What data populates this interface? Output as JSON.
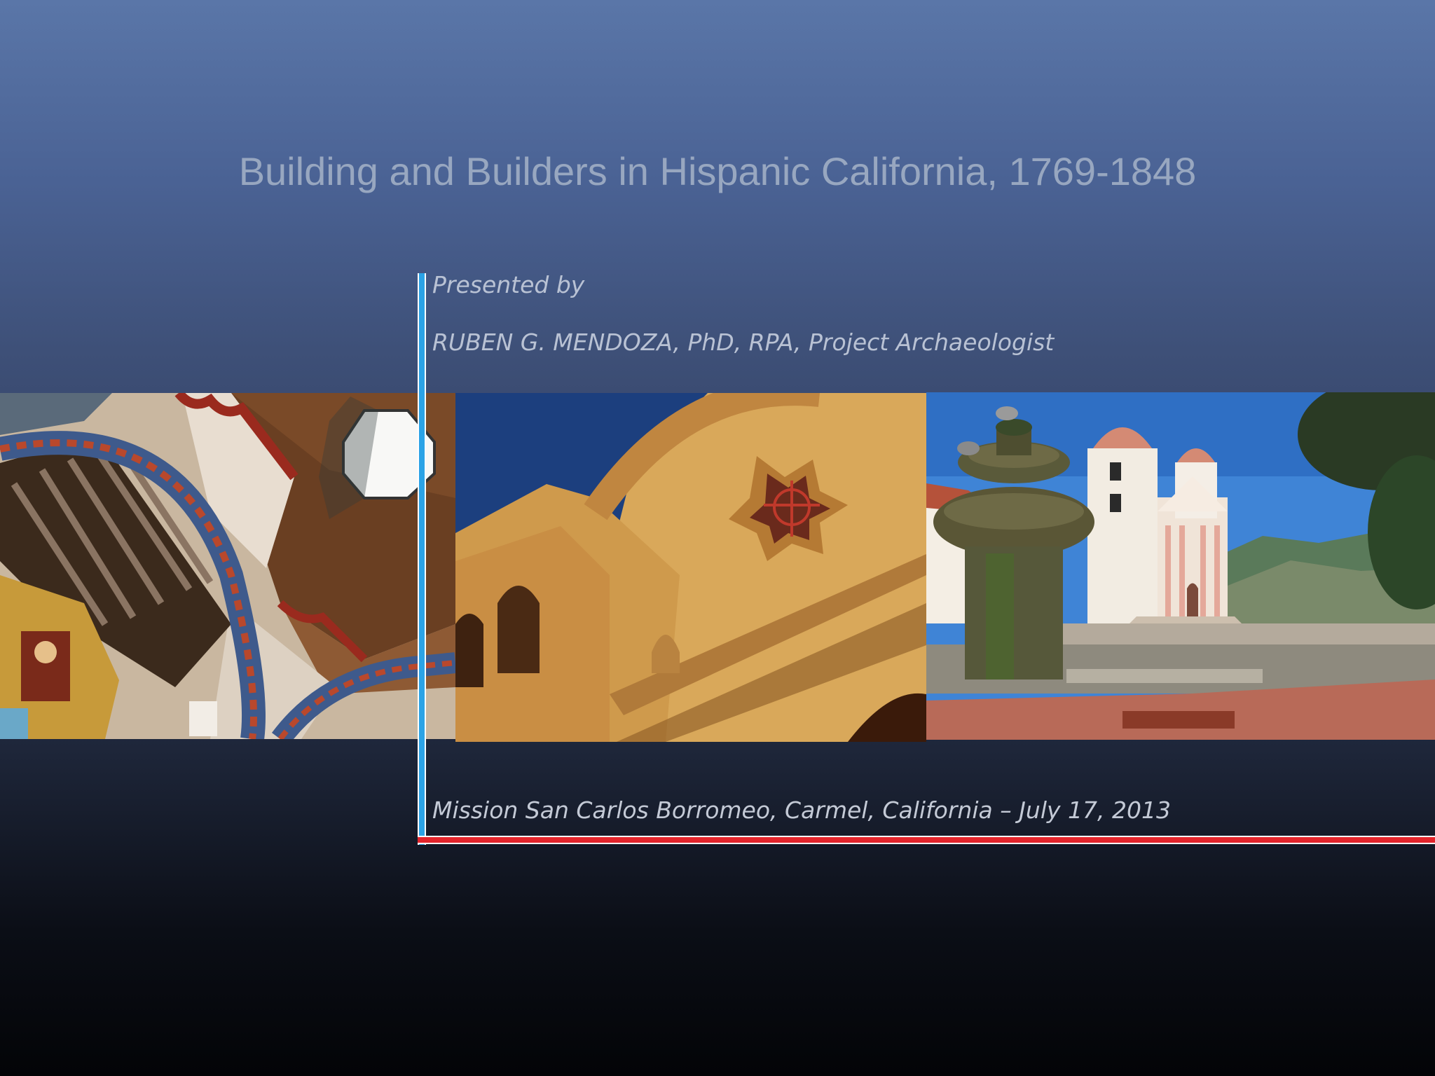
{
  "slide": {
    "title": "Building and Builders in Hispanic California, 1769-1848",
    "presented_by": "Presented by",
    "presenter": "RUBEN G. MENDOZA, PhD, RPA, Project Archaeologist",
    "event_line": "Mission San Carlos Borromeo, Carmel, California – July 17, 2013"
  },
  "photos": [
    {
      "icon": "mission-interior-ceiling-photo"
    },
    {
      "icon": "mission-facade-star-window-photo"
    },
    {
      "icon": "mission-fountain-bell-towers-photo"
    }
  ],
  "colors": {
    "title": "#98a7c0",
    "vertical_accent": "#2ba3e6",
    "horizontal_accent": "#e3242b"
  }
}
